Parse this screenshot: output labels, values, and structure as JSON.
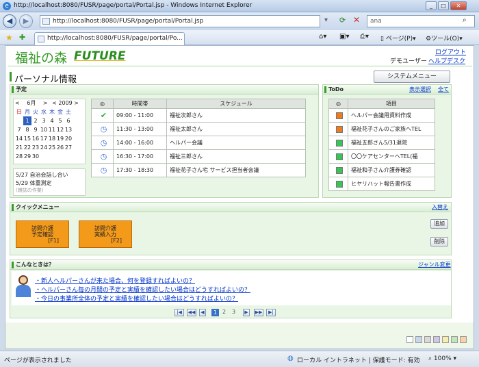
{
  "window": {
    "title": "http://localhost:8080/FUSR/page/portal/Portal.jsp - Windows Internet Explorer",
    "min": "_",
    "max": "□",
    "close": "✕"
  },
  "browser": {
    "address": "http://localhost:8080/FUSR/page/portal/Portal.jsp",
    "search_value": "ana",
    "tab_title": "http://localhost:8080/FUSR/page/portal/Po...",
    "page_menu": "ページ(P)",
    "tools_menu": "ツール(O)"
  },
  "header": {
    "logo": "福祉の森",
    "logo_future": "FUTURE",
    "logout": "ログアウト",
    "user": "デモユーザー",
    "helpdesk": "ヘルプデスク"
  },
  "page": {
    "title": "パーソナル情報",
    "system_menu": "システムメニュー"
  },
  "schedule": {
    "title": "予定",
    "cal_month": "6月",
    "cal_year": "2009",
    "weekdays": [
      "日",
      "月",
      "火",
      "水",
      "木",
      "金",
      "土"
    ],
    "weeks": [
      [
        "",
        "1",
        "2",
        "3",
        "4",
        "5",
        "6"
      ],
      [
        "7",
        "8",
        "9",
        "10",
        "11",
        "12",
        "13"
      ],
      [
        "14",
        "15",
        "16",
        "17",
        "18",
        "19",
        "20"
      ],
      [
        "21",
        "22",
        "23",
        "24",
        "25",
        "26",
        "27"
      ],
      [
        "28",
        "29",
        "30",
        "",
        "",
        "",
        ""
      ]
    ],
    "notes": [
      "5/27 自治会話し合い",
      "5/29 体重測定"
    ],
    "note_sub": "(雑誌の作業)",
    "col_time": "時間帯",
    "col_schedule": "スケジュール",
    "rows": [
      {
        "time": "09:00 - 11:00",
        "text": "福祉次郎さん"
      },
      {
        "time": "11:30 - 13:00",
        "text": "福祉太郎さん"
      },
      {
        "time": "14:00 - 16:00",
        "text": "ヘルパー会議"
      },
      {
        "time": "16:30 - 17:00",
        "text": "福祉三郎さん"
      },
      {
        "time": "17:30 - 18:30",
        "text": "福祉花子さん宅 サービス担当者会議"
      }
    ]
  },
  "todo": {
    "title": "ToDo",
    "display_select": "表示選択",
    "all": "全て",
    "col_item": "項目",
    "items": [
      "ヘルパー会議用資料作成",
      "福祉花子さんのご家族へTEL",
      "福祉五郎さん5/31退院",
      "〇〇ケアセンターへTEL(福",
      "福祉和子さん介護券確認",
      "ヒヤリハット報告書作成"
    ],
    "colors": [
      "#f07b1f",
      "#f07b1f",
      "#39c457",
      "#39c457",
      "#39c457",
      "#39c457"
    ]
  },
  "quick": {
    "title": "クイックメニュー",
    "replace": "入替え",
    "btn1_l1": "訪問介護",
    "btn1_l2": "予定確認",
    "btn1_key": "[F1]",
    "btn2_l1": "訪問介護",
    "btn2_l2": "実績入力",
    "btn2_key": "[F2]",
    "add": "追加",
    "delete": "削除"
  },
  "faq": {
    "title": "こんなときは？",
    "genre": "ジャンル変更",
    "links": [
      "・新人ヘルパーさんが来た場合、何を登録すればよいの？",
      "・ヘルパーさん毎の月間の予定と実績を確認したい場合はどうすればよいの？",
      "・今日の事業所全体の予定と実績を確認したい場合はどうすればよいの？"
    ],
    "pages": [
      "1",
      "2",
      "3"
    ]
  },
  "status": {
    "left": "ページが表示されました",
    "zone": "ローカル イントラネット | 保護モード: 有効",
    "zoom": "100%"
  }
}
